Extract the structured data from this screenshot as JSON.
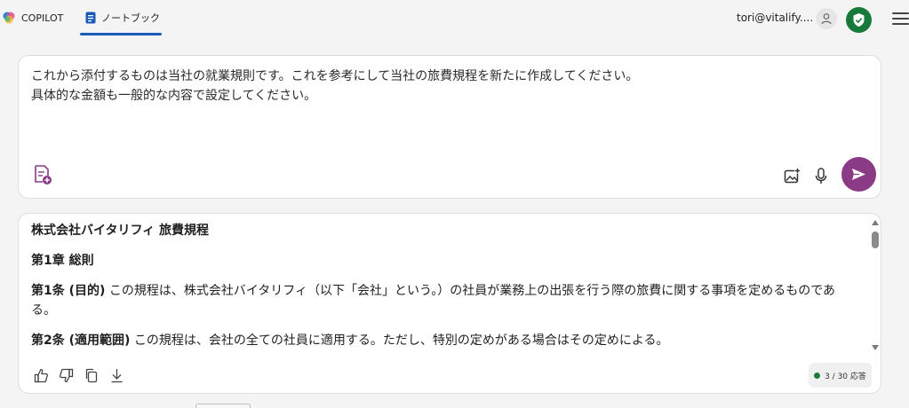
{
  "topbar": {
    "tabs": [
      {
        "label": "COPILOT",
        "icon": "copilot-logo-icon"
      },
      {
        "label": "ノートブック",
        "icon": "notebook-icon",
        "active": true
      }
    ],
    "account_email": "tori@vitalify....",
    "accent_color": "#1a5ab8"
  },
  "composer": {
    "text": "これから添付するものは当社の就業規則です。これを参考にして当社の旅費規程を新たに作成してください。\n具体的な金額も一般的な内容で設定してください。",
    "send_color": "#8b3a86"
  },
  "response": {
    "title": "株式会社バイタリフィ 旅費規程",
    "chapter": "第1章 総則",
    "article1_label": "第1条 (目的)",
    "article1_text": " この規程は、株式会社バイタリフィ（以下「会社」という。）の社員が業務上の出張を行う際の旅費に関する事項を定めるものである。",
    "article2_label": "第2条 (適用範囲)",
    "article2_text": " この規程は、会社の全ての社員に適用する。ただし、特別の定めがある場合はその定めによる。",
    "response_count": "3 / 30 応答"
  }
}
